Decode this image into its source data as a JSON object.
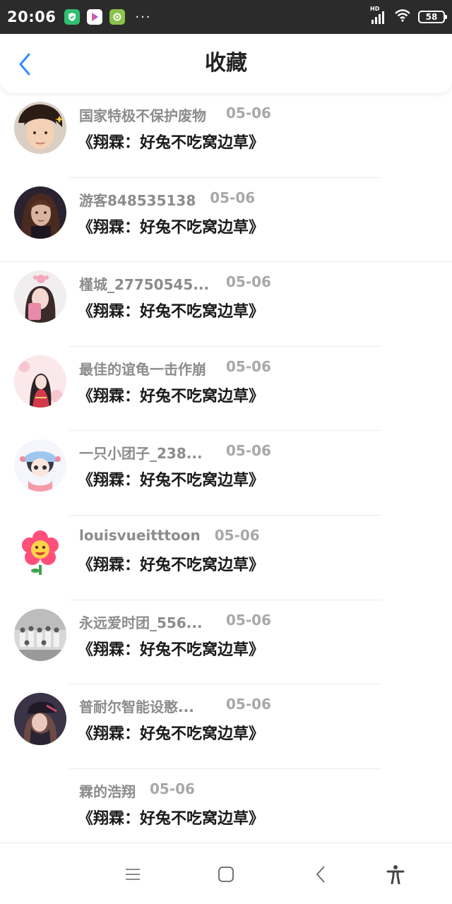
{
  "status_bar": {
    "time": "20:06",
    "dots": "···",
    "network_label": "HD",
    "battery": "58",
    "icons": [
      "shield-app-icon",
      "play-app-icon",
      "settings-app-icon",
      "signal-icon",
      "wifi-icon",
      "battery-icon"
    ]
  },
  "header": {
    "title": "收藏",
    "back_icon": "chevron-left-icon",
    "accent_color": "#2f8cff"
  },
  "favorites": [
    {
      "user": "国家特极不保护废物",
      "date": "05-06",
      "title": "《翔霖：好兔不吃窝边草》",
      "avatar": "avatar-boy-photo"
    },
    {
      "user": "游客848535138",
      "date": "05-06",
      "title": "《翔霖：好兔不吃窝边草》",
      "avatar": "avatar-anime-man"
    },
    {
      "user": "槿城_27750545...",
      "date": "05-06",
      "title": "《翔霖：好兔不吃窝边草》",
      "avatar": "avatar-girl-pink"
    },
    {
      "user": "最佳的谊龟一击作崩",
      "date": "05-06",
      "title": "《翔霖：好兔不吃窝边草》",
      "avatar": "avatar-illustration-girl"
    },
    {
      "user": "一只小团子_238...",
      "date": "05-06",
      "title": "《翔霖：好兔不吃窝边草》",
      "avatar": "avatar-cartoon-girl"
    },
    {
      "user": "louisvueitttoon",
      "date": "05-06",
      "title": "《翔霖：好兔不吃窝边草》",
      "avatar": "avatar-flower"
    },
    {
      "user": "永远爱时团_556...",
      "date": "05-06",
      "title": "《翔霖：好兔不吃窝边草》",
      "avatar": "avatar-group-photo"
    },
    {
      "user": "普耐尔智能设憨...",
      "date": "05-06",
      "title": "《翔霖：好兔不吃窝边草》",
      "avatar": "avatar-cap-girl"
    },
    {
      "user": "霖的浩翔",
      "date": "05-06",
      "title": "《翔霖：好兔不吃窝边草》",
      "avatar": ""
    }
  ],
  "nav_bar": {
    "icons": [
      "menu-icon",
      "home-square-icon",
      "back-icon",
      "accessibility-icon"
    ]
  }
}
